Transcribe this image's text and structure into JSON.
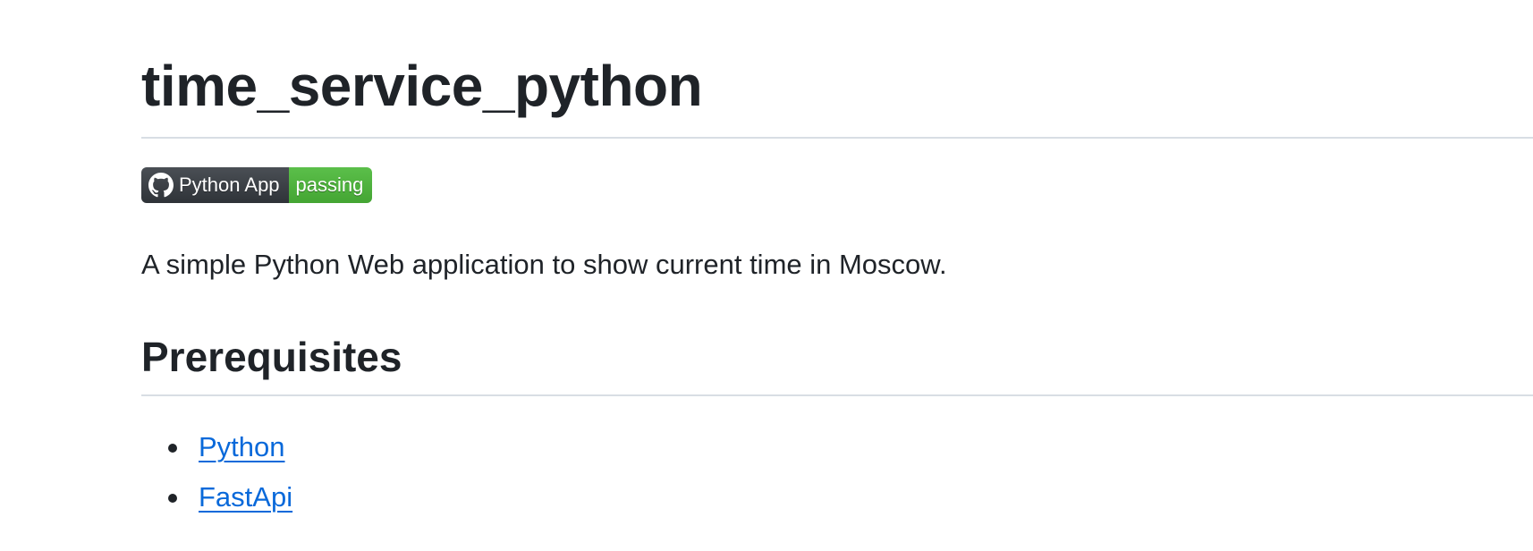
{
  "readme": {
    "title": "time_service_python",
    "badge": {
      "icon": "github-icon",
      "label": "Python App",
      "status": "passing",
      "colors": {
        "label_bg": "#33373c",
        "status_bg": "#4cb13b"
      }
    },
    "description": "A simple Python Web application to show current time in Moscow.",
    "sections": [
      {
        "heading": "Prerequisites",
        "items": [
          {
            "label": "Python"
          },
          {
            "label": "FastApi"
          }
        ]
      }
    ],
    "colors": {
      "text": "#1f2328",
      "link": "#0969da",
      "divider": "#d8dee4"
    }
  }
}
